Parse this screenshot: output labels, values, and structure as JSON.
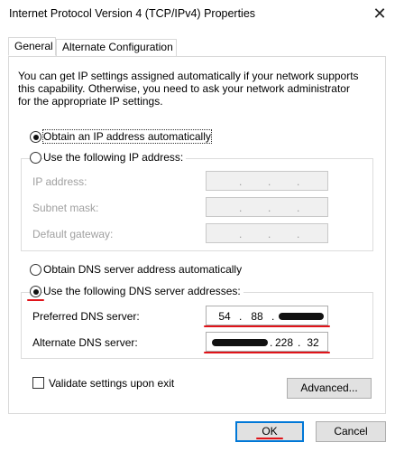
{
  "window": {
    "title": "Internet Protocol Version 4 (TCP/IPv4) Properties",
    "close_glyph": "✕"
  },
  "tabs": [
    {
      "label": "General",
      "active": true
    },
    {
      "label": "Alternate Configuration",
      "active": false
    }
  ],
  "intro_text": "You can get IP settings assigned automatically if your network supports\nthis capability. Otherwise, you need to ask your network administrator\nfor the appropriate IP settings.",
  "ip_mode": {
    "auto_label": "Obtain an IP address automatically",
    "manual_label": "Use the following IP address:",
    "selected": "auto",
    "fields": [
      {
        "label": "IP address:",
        "value": ". . ."
      },
      {
        "label": "Subnet mask:",
        "value": ". . ."
      },
      {
        "label": "Default gateway:",
        "value": ". . ."
      }
    ]
  },
  "dns_mode": {
    "auto_label": "Obtain DNS server address automatically",
    "manual_label": "Use the following DNS server addresses:",
    "selected": "manual",
    "preferred": {
      "label": "Preferred DNS server:",
      "octets": [
        "54",
        "88",
        "",
        ""
      ]
    },
    "alternate": {
      "label": "Alternate DNS server:",
      "octets": [
        "",
        "",
        "228",
        "32"
      ]
    }
  },
  "validate": {
    "label": "Validate settings upon exit",
    "checked": false
  },
  "buttons": {
    "advanced": "Advanced...",
    "ok": "OK",
    "cancel": "Cancel"
  },
  "colors": {
    "accent": "#0078d7",
    "annotation_red": "#e0141a"
  }
}
